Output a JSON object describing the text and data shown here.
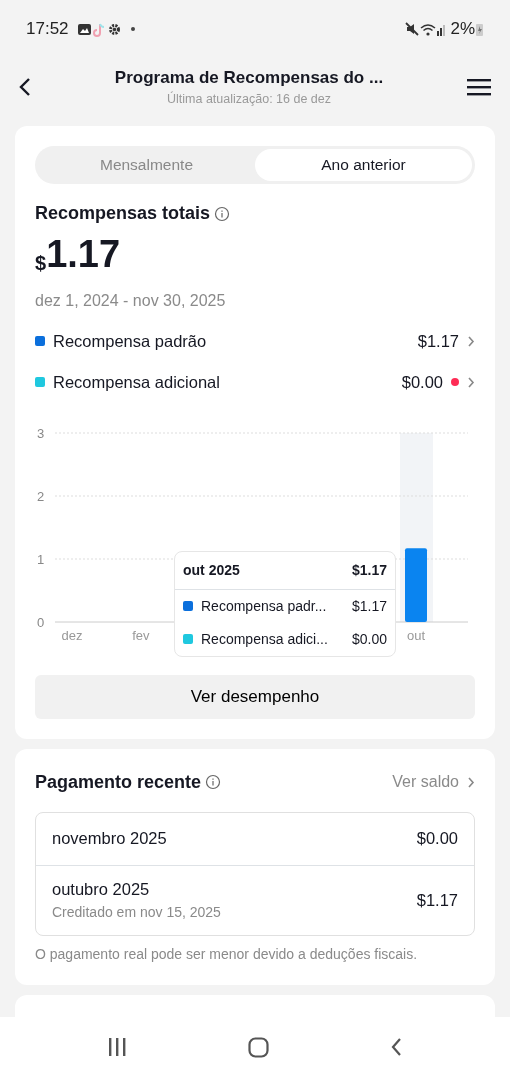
{
  "status_bar": {
    "time": "17:52",
    "battery": "2%"
  },
  "header": {
    "title": "Programa de Recompensas do ...",
    "subtitle": "Última atualização: 16 de dez"
  },
  "tabs": [
    {
      "label": "Mensalmente",
      "selected": false
    },
    {
      "label": "Ano anterior",
      "selected": true
    }
  ],
  "summary": {
    "title": "Recompensas totais",
    "currency": "$",
    "amount": "1.17",
    "period": "dez 1, 2024 - nov 30, 2025"
  },
  "breakdown": [
    {
      "label": "Recompensa padrão",
      "value": "$1.17",
      "color": "#0b6fdc",
      "alert": false
    },
    {
      "label": "Recompensa adicional",
      "value": "$0.00",
      "color": "#1fc8df",
      "alert": true
    }
  ],
  "chart": {
    "chart_data": {
      "type": "bar",
      "categories": [
        "dez",
        null,
        "fev",
        null,
        null,
        null,
        null,
        null,
        null,
        null,
        "out",
        null
      ],
      "series": [
        {
          "color": "#0a84f0",
          "values": [
            0,
            0,
            0,
            0,
            0,
            0,
            0,
            0,
            0,
            0,
            1.17,
            0
          ]
        }
      ],
      "ylim": [
        0,
        3
      ],
      "yticks": [
        0,
        1,
        2,
        3
      ]
    },
    "tooltip": {
      "title": "out 2025",
      "total": "$1.17",
      "rows": [
        {
          "label": "Recompensa padr...",
          "value": "$1.17",
          "color": "#0b6fdc"
        },
        {
          "label": "Recompensa adici...",
          "value": "$0.00",
          "color": "#1fc8df"
        }
      ]
    }
  },
  "performance_button": "Ver desempenho",
  "payments": {
    "title": "Pagamento recente",
    "link": "Ver saldo",
    "rows": [
      {
        "month": "novembro 2025",
        "amount": "$0.00"
      },
      {
        "month": "outubro 2025",
        "note": "Creditado em nov 15, 2025",
        "amount": "$1.17"
      }
    ],
    "footnote": "O pagamento real pode ser menor devido a deduções fiscais."
  }
}
